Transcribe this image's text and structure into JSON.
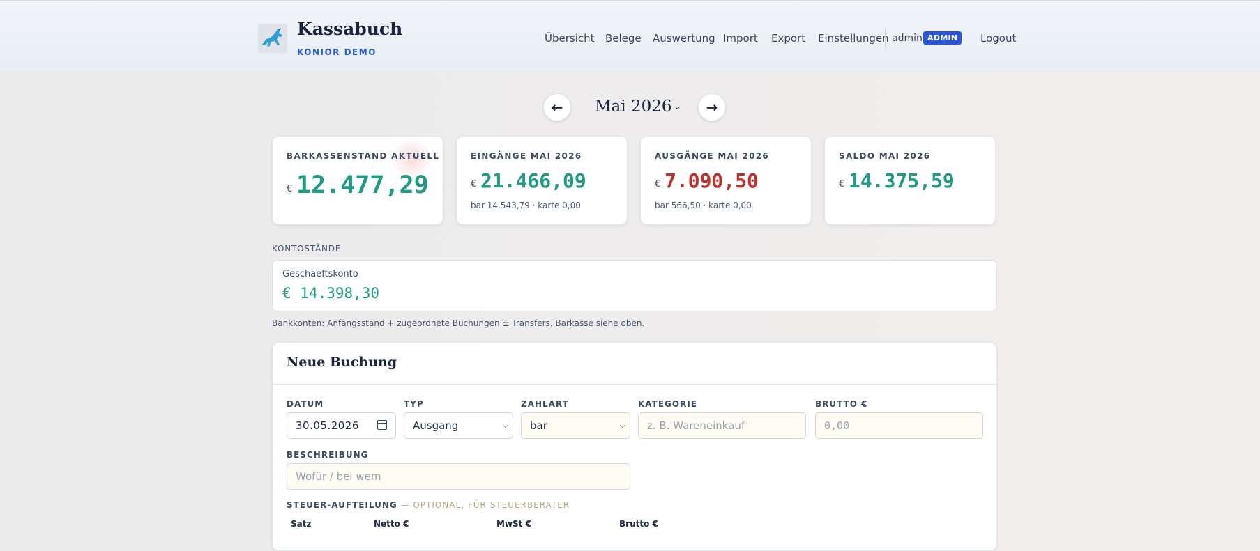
{
  "header": {
    "brand_title": "Kassabuch",
    "brand_subtitle": "KONIOR DEMO",
    "nav": [
      "Übersicht",
      "Belege",
      "Auswertung",
      "Import",
      "Export",
      "Einstellungen"
    ],
    "user": "admin",
    "user_badge": "ADMIN",
    "logout": "Logout"
  },
  "month_nav": {
    "prev": "←",
    "title": "Mai 2026",
    "chevron": "⌄",
    "next": "→"
  },
  "cards": [
    {
      "label": "BARKASSENSTAND AKTUELL",
      "currency": "€",
      "value": "12.477,29",
      "sub": ""
    },
    {
      "label": "EINGÄNGE MAI 2026",
      "currency": "€",
      "value": "21.466,09",
      "sub": "bar 14.543,79 · karte 0,00"
    },
    {
      "label": "AUSGÄNGE MAI 2026",
      "currency": "€",
      "value": "7.090,50",
      "sub": "bar 566,50 · karte 0,00"
    },
    {
      "label": "SALDO MAI 2026",
      "currency": "€",
      "value": "14.375,59",
      "sub": ""
    }
  ],
  "colors": {
    "positive": "#1f9a83",
    "negative": "#c0302a",
    "accent": "#2a55d9"
  },
  "konten": {
    "label": "KONTOSTÄNDE",
    "account_name": "Geschaeftskonto",
    "account_value": "€ 14.398,30",
    "note": "Bankkonten: Anfangsstand + zugeordnete Buchungen ± Transfers. Barkasse siehe oben."
  },
  "form": {
    "title": "Neue Buchung",
    "datum_label": "DATUM",
    "datum_value": "30.05.2026",
    "typ_label": "TYP",
    "typ_value": "Ausgang",
    "zahlart_label": "ZAHLART",
    "zahlart_value": "bar",
    "kategorie_label": "KATEGORIE",
    "kategorie_placeholder": "z. B. Wareneinkauf",
    "brutto_label": "BRUTTO €",
    "brutto_placeholder": "0,00",
    "beschreibung_label": "BESCHREIBUNG",
    "beschreibung_placeholder": "Wofür / bei wem",
    "tax_label": "STEUER-AUFTEILUNG",
    "tax_optional": " — OPTIONAL, FÜR STEUERBERATER",
    "tax_columns": [
      "Satz",
      "Netto €",
      "MwSt €",
      "Brutto €"
    ]
  }
}
